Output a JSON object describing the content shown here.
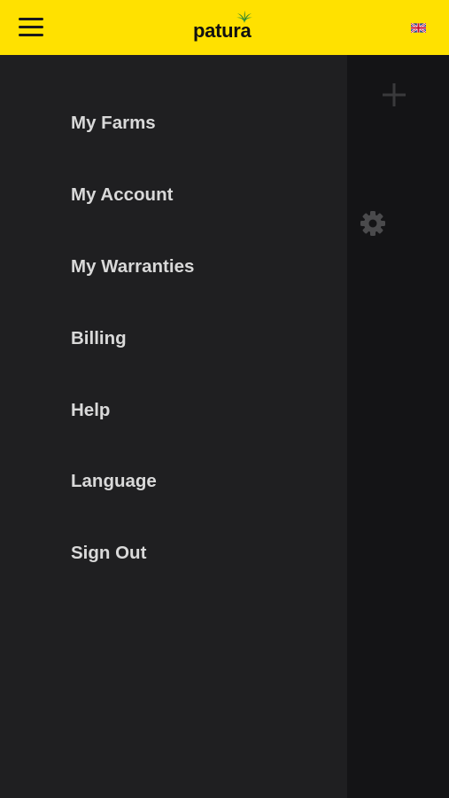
{
  "header": {
    "logo_text": "patura",
    "menu_icon": "hamburger-menu-icon",
    "language_flag_icon": "uk-flag-icon",
    "background_color": "#ffe100"
  },
  "menu": {
    "items": [
      {
        "label": "My Farms"
      },
      {
        "label": "My Account"
      },
      {
        "label": "My Warranties"
      },
      {
        "label": "Billing"
      },
      {
        "label": "Help"
      },
      {
        "label": "Language"
      },
      {
        "label": "Sign Out"
      }
    ]
  },
  "background_screen": {
    "icons": [
      "plus-icon",
      "gear-icon"
    ]
  },
  "colors": {
    "accent_yellow": "#ffe100",
    "drawer_bg": "#1f1f21",
    "menu_text": "#d9d9d9"
  }
}
